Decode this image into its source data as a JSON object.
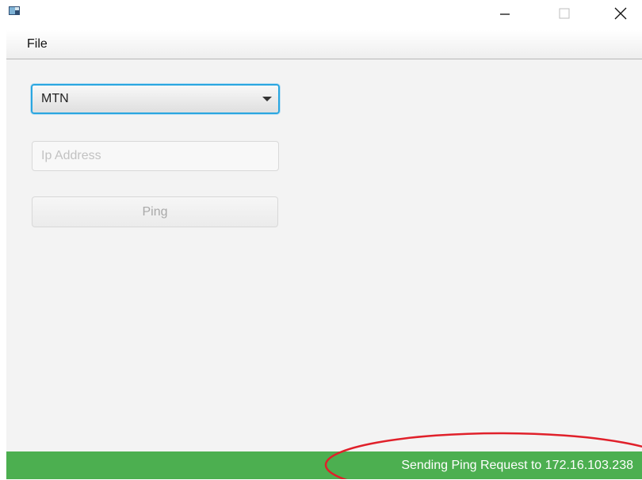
{
  "window": {
    "controls": [
      "minimize",
      "maximize",
      "close"
    ]
  },
  "icons": {
    "app": "app-icon",
    "minimize": "minimize-icon",
    "maximize": "maximize-icon",
    "close": "close-icon",
    "dropdown": "chevron-down-icon"
  },
  "menubar": {
    "items": [
      {
        "label": "File"
      }
    ]
  },
  "form": {
    "carrier": {
      "selected": "MTN"
    },
    "ip_address": {
      "value": "",
      "placeholder": "Ip Address"
    },
    "ping_label": "Ping"
  },
  "status": {
    "message": "Sending Ping Request to 172.16.103.238"
  },
  "colors": {
    "status_bar": "#4caf50",
    "focus_ring": "#2aa6e0",
    "annotation": "#e0202a",
    "background": "#f3f3f3"
  }
}
